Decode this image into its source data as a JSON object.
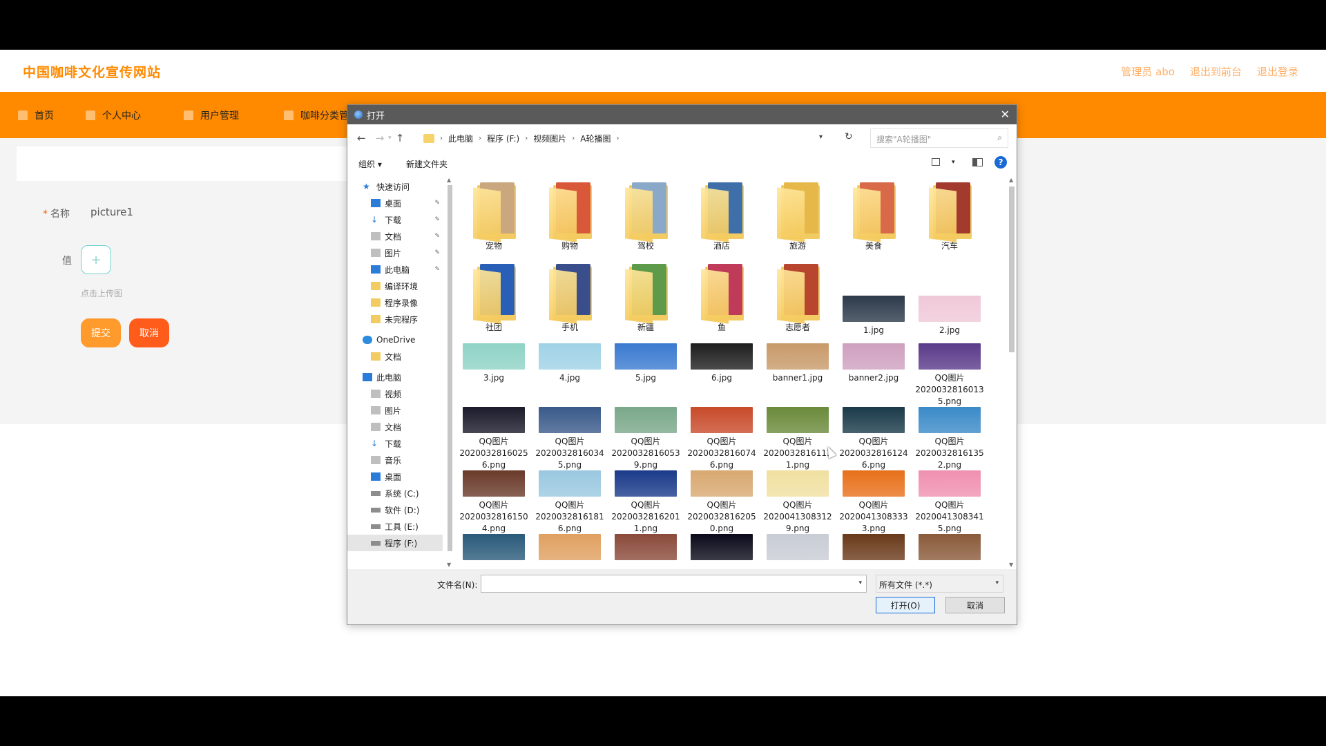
{
  "site": {
    "title": "中国咖啡文化宣传网站",
    "header_links": [
      "管理员 abo",
      "退出到前台",
      "退出登录"
    ],
    "nav": [
      "首页",
      "个人中心",
      "用户管理",
      "咖啡分类管"
    ],
    "form": {
      "name_label": "名称",
      "name_value": "picture1",
      "value_label": "值",
      "upload_plus": "+",
      "hint": "点击上传图",
      "submit": "提交",
      "cancel": "取消"
    }
  },
  "dialog": {
    "title": "打开",
    "path": [
      "此电脑",
      "程序 (F:)",
      "视频图片",
      "A轮播图"
    ],
    "search_placeholder": "搜索\"A轮播图\"",
    "toolbar": {
      "organize": "组织 ▾",
      "new_folder": "新建文件夹",
      "help": "?"
    },
    "nav_pane": [
      {
        "label": "快速访问",
        "icon": "star",
        "indent": 0,
        "pin": false
      },
      {
        "label": "桌面",
        "icon": "blue",
        "indent": 1,
        "pin": true
      },
      {
        "label": "下载",
        "icon": "down",
        "indent": 1,
        "pin": true
      },
      {
        "label": "文档",
        "icon": "gray",
        "indent": 1,
        "pin": true
      },
      {
        "label": "图片",
        "icon": "gray",
        "indent": 1,
        "pin": true
      },
      {
        "label": "此电脑",
        "icon": "blue",
        "indent": 1,
        "pin": true
      },
      {
        "label": "编译环境",
        "icon": "folder",
        "indent": 1,
        "pin": false
      },
      {
        "label": "程序录像",
        "icon": "folder",
        "indent": 1,
        "pin": false
      },
      {
        "label": "未完程序",
        "icon": "folder",
        "indent": 1,
        "pin": false
      },
      {
        "label": "OneDrive",
        "icon": "cloud",
        "indent": 0,
        "pin": false
      },
      {
        "label": "文档",
        "icon": "folder",
        "indent": 1,
        "pin": false
      },
      {
        "label": "此电脑",
        "icon": "blue",
        "indent": 0,
        "pin": false
      },
      {
        "label": "视频",
        "icon": "gray",
        "indent": 1,
        "pin": false
      },
      {
        "label": "图片",
        "icon": "gray",
        "indent": 1,
        "pin": false
      },
      {
        "label": "文档",
        "icon": "gray",
        "indent": 1,
        "pin": false
      },
      {
        "label": "下载",
        "icon": "down",
        "indent": 1,
        "pin": false
      },
      {
        "label": "音乐",
        "icon": "gray",
        "indent": 1,
        "pin": false
      },
      {
        "label": "桌面",
        "icon": "blue",
        "indent": 1,
        "pin": false
      },
      {
        "label": "系统 (C:)",
        "icon": "drive",
        "indent": 1,
        "pin": false
      },
      {
        "label": "软件 (D:)",
        "icon": "drive",
        "indent": 1,
        "pin": false
      },
      {
        "label": "工具 (E:)",
        "icon": "drive",
        "indent": 1,
        "pin": false
      },
      {
        "label": "程序 (F:)",
        "icon": "drive",
        "indent": 1,
        "pin": false,
        "selected": true
      }
    ],
    "folders": [
      {
        "name": "宠物",
        "color": "#caa77e"
      },
      {
        "name": "购物",
        "color": "#d9583a"
      },
      {
        "name": "驾校",
        "color": "#8aa8c8"
      },
      {
        "name": "酒店",
        "color": "#3f6fa8"
      },
      {
        "name": "旅游",
        "color": "#e6b84a"
      },
      {
        "name": "美食",
        "color": "#d86a4a"
      },
      {
        "name": "汽车",
        "color": "#a23a2e"
      },
      {
        "name": "社团",
        "color": "#2a5fb8"
      },
      {
        "name": "手机",
        "color": "#3b4e8c"
      },
      {
        "name": "新疆",
        "color": "#5d9a4a"
      },
      {
        "name": "鱼",
        "color": "#c03a5a"
      },
      {
        "name": "志愿者",
        "color": "#b8462e"
      }
    ],
    "images": [
      {
        "name": "1.jpg",
        "color": "#2c3a4a"
      },
      {
        "name": "2.jpg",
        "color": "#f0c8d8"
      },
      {
        "name": "3.jpg",
        "color": "#8fd3c6"
      },
      {
        "name": "4.jpg",
        "color": "#9fd2e6"
      },
      {
        "name": "5.jpg",
        "color": "#3a7ad0"
      },
      {
        "name": "6.jpg",
        "color": "#1e1e1e"
      },
      {
        "name": "banner1.jpg",
        "color": "#c89a6a"
      },
      {
        "name": "banner2.jpg",
        "color": "#cfa0c0"
      },
      {
        "name": "QQ图片\n2020032816013\n5.png",
        "color": "#5a3a8a"
      },
      {
        "name": "QQ图片\n2020032816025\n6.png",
        "color": "#1a1a2a"
      },
      {
        "name": "QQ图片\n2020032816034\n5.png",
        "color": "#3a5a8a"
      },
      {
        "name": "QQ图片\n2020032816053\n9.png",
        "color": "#7aa88a"
      },
      {
        "name": "QQ图片\n2020032816074\n6.png",
        "color": "#c84a2a"
      },
      {
        "name": "QQ图片\n2020032816113\n1.png",
        "color": "#6a8a3a"
      },
      {
        "name": "QQ图片\n2020032816124\n6.png",
        "color": "#1a3a4a"
      },
      {
        "name": "QQ图片\n2020032816135\n2.png",
        "color": "#3a8ac8"
      },
      {
        "name": "QQ图片\n2020032816150\n4.png",
        "color": "#6a3a2a"
      },
      {
        "name": "QQ图片\n2020032816181\n6.png",
        "color": "#9ac8e0"
      },
      {
        "name": "QQ图片\n2020032816201\n1.png",
        "color": "#1a3a8a"
      },
      {
        "name": "QQ图片\n2020032816205\n0.png",
        "color": "#d8a870"
      },
      {
        "name": "QQ图片\n2020041308312\n9.png",
        "color": "#f0e0a0"
      },
      {
        "name": "QQ图片\n2020041308333\n3.png",
        "color": "#e8701a"
      },
      {
        "name": "QQ图片\n2020041308341\n5.png",
        "color": "#f090b0"
      },
      {
        "name": "",
        "color": "#2a5a7a"
      },
      {
        "name": "",
        "color": "#e0a060"
      },
      {
        "name": "",
        "color": "#8a4a3a"
      },
      {
        "name": "",
        "color": "#0a0a1a"
      },
      {
        "name": "",
        "color": "#c8ccd4"
      },
      {
        "name": "",
        "color": "#6a3a1a"
      },
      {
        "name": "",
        "color": "#8a5a3a"
      }
    ],
    "filename_label": "文件名(N):",
    "filename_value": "",
    "filter": "所有文件 (*.*)",
    "open_button": "打开(O)",
    "cancel_button": "取消"
  }
}
